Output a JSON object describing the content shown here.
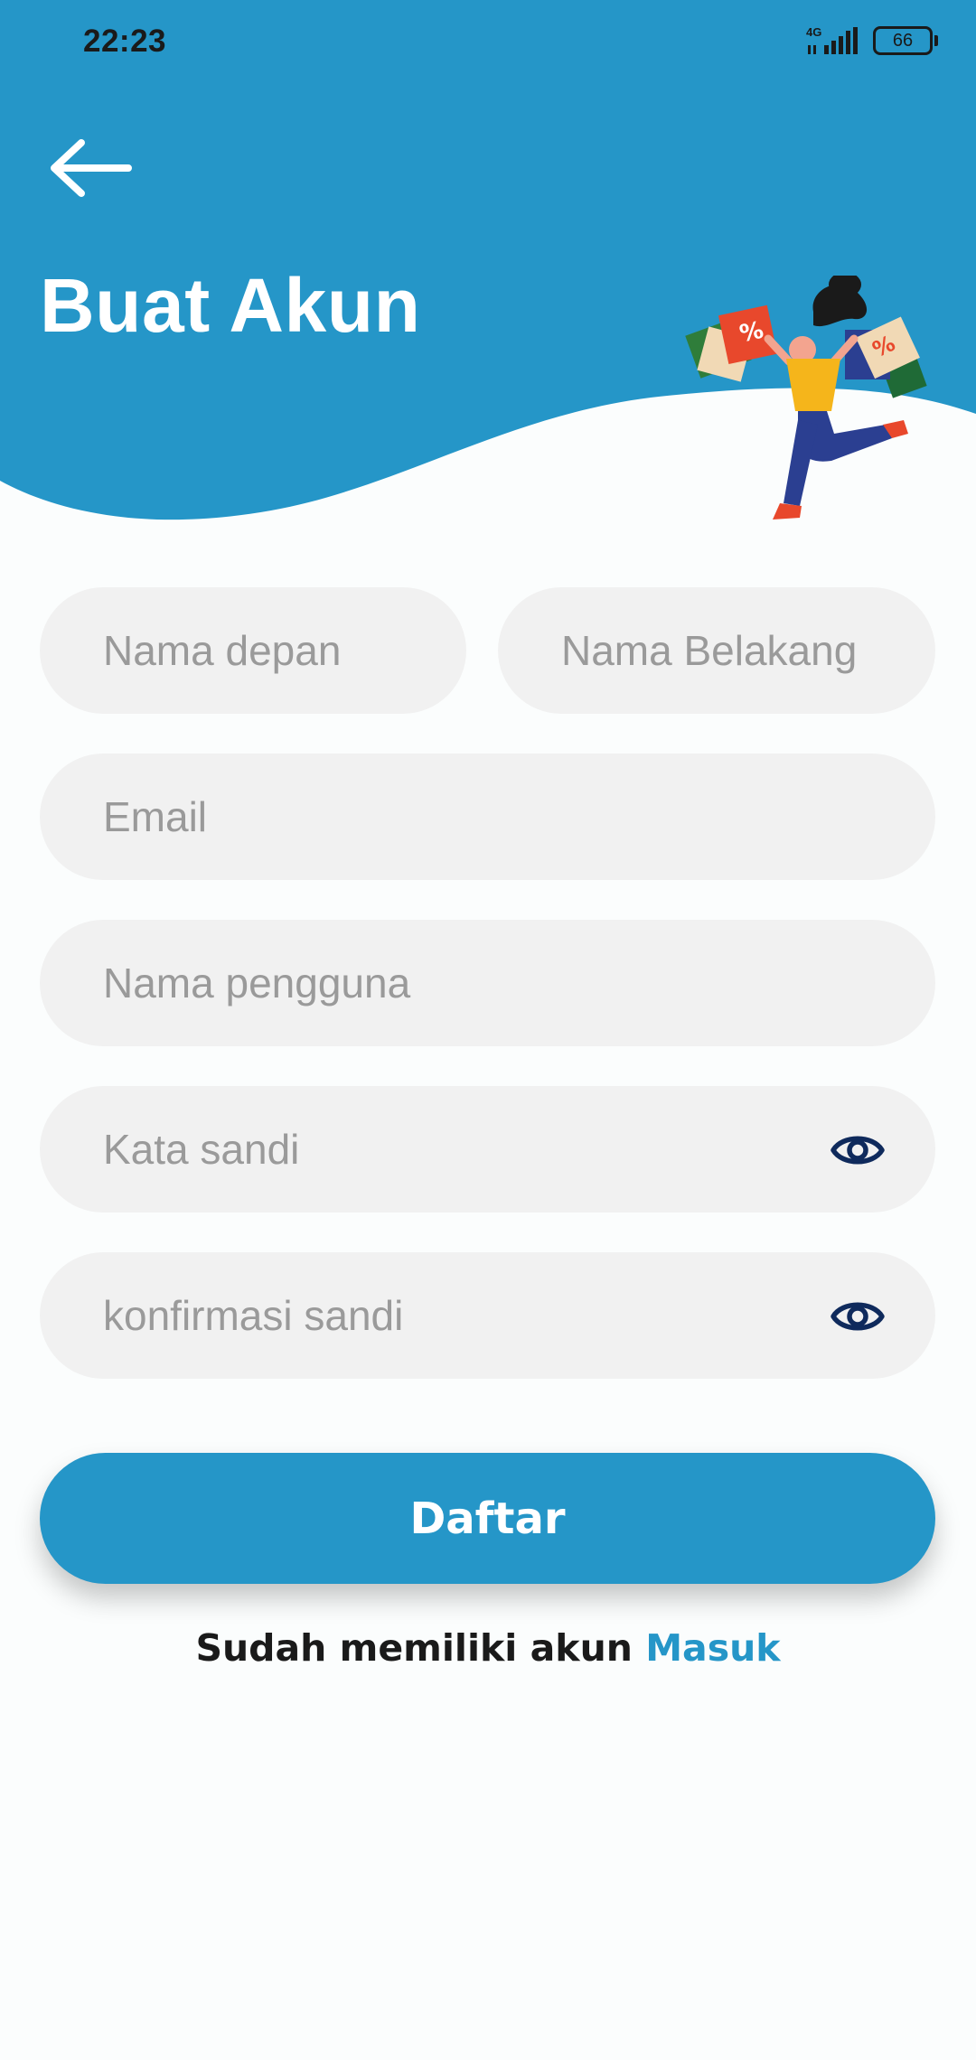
{
  "status_bar": {
    "time": "22:23",
    "network": "4G",
    "battery": "66"
  },
  "header": {
    "title": "Buat Akun",
    "back_icon": "arrow-left-icon",
    "background_color": "#2596c8"
  },
  "form": {
    "first_name_placeholder": "Nama depan",
    "last_name_placeholder": "Nama Belakang",
    "email_placeholder": "Email",
    "username_placeholder": "Nama pengguna",
    "password_placeholder": "Kata sandi",
    "confirm_password_placeholder": "konfirmasi sandi",
    "field_background": "#f1f1f1",
    "eye_icon_color": "#0f2a5c"
  },
  "submit": {
    "label": "Daftar",
    "color": "#2596c8"
  },
  "footer": {
    "prompt": "Sudah memiliki akun",
    "link": "Masuk",
    "link_color": "#2596c8"
  }
}
